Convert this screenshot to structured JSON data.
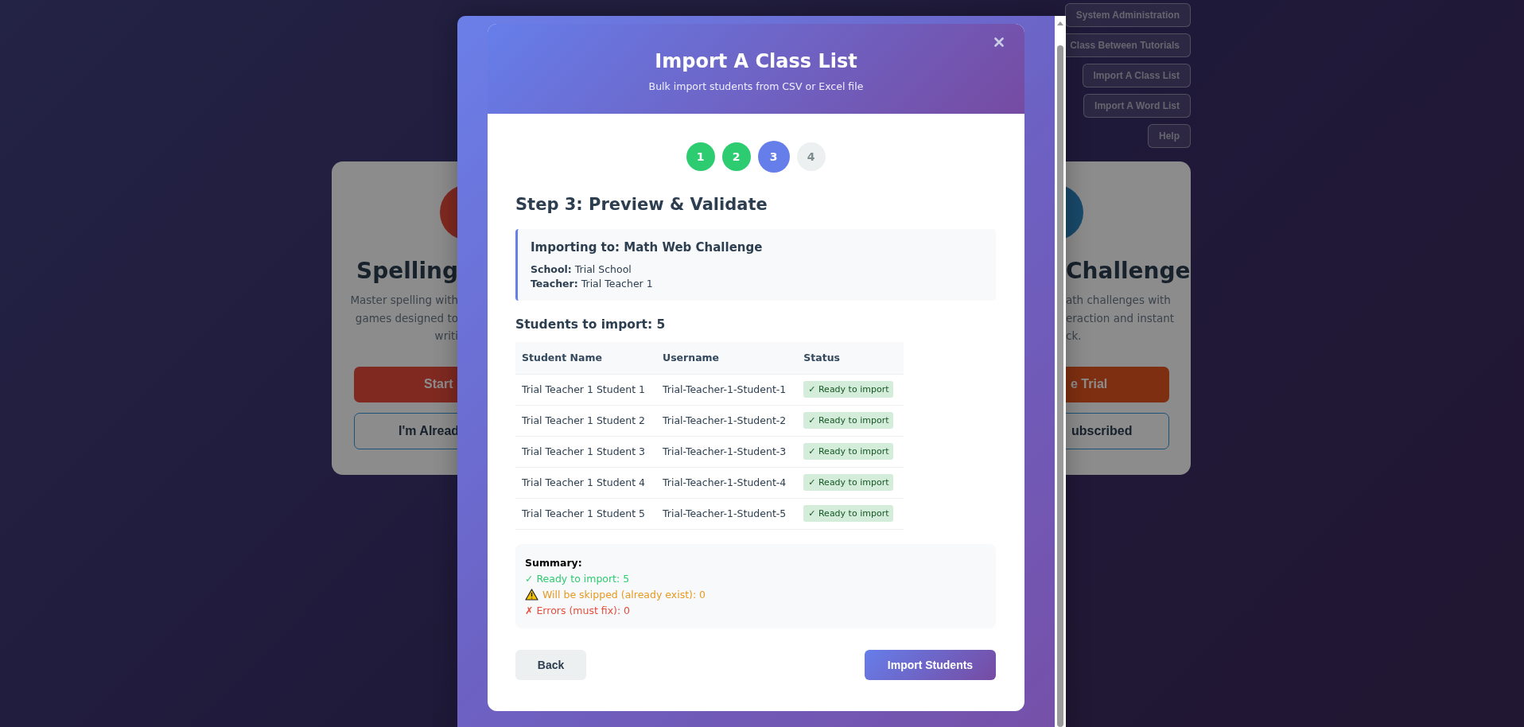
{
  "nav_buttons": [
    "System Administration",
    "Class Between Tutorials",
    "Import A Class List",
    "Import A Word List",
    "Help"
  ],
  "cards": [
    {
      "kind": "cut_right",
      "title": "Spelling",
      "description": [
        "Master spelling with",
        "games designed to",
        "writi"
      ],
      "primary_button": "Start",
      "secondary_button": "I'm Alread"
    },
    {
      "kind": "cut_left",
      "title": "Challenge",
      "description": [
        "ath challenges with",
        "eraction and instant",
        "ck."
      ],
      "primary_button": "e Trial",
      "secondary_button": "ubscribed"
    }
  ],
  "dialog": {
    "title": "Import A Class List",
    "subtitle": "Bulk import students from CSV or Excel file",
    "steps": [
      {
        "label": "1",
        "done": true,
        "selected": false
      },
      {
        "label": "2",
        "done": true,
        "selected": false
      },
      {
        "label": "3",
        "done": false,
        "selected": true
      },
      {
        "label": "4",
        "done": false,
        "selected": false
      }
    ],
    "heading": "Step 3: Preview & Validate",
    "target": {
      "title": "Importing to: Math Web Challenge",
      "lines": [
        "**School:** Trial School",
        "**Teacher:** Trial Teacher 1"
      ]
    },
    "students_heading": "Students to import: 5",
    "table": {
      "columns": [
        "Student Name",
        "Username",
        "Status"
      ],
      "rows": [
        {
          "name": "Trial Teacher 1 Student 1",
          "username": "Trial-Teacher-1-Student-1",
          "status": "✓ Ready to import"
        },
        {
          "name": "Trial Teacher 1 Student 2",
          "username": "Trial-Teacher-1-Student-2",
          "status": "✓ Ready to import"
        },
        {
          "name": "Trial Teacher 1 Student 3",
          "username": "Trial-Teacher-1-Student-3",
          "status": "✓ Ready to import"
        },
        {
          "name": "Trial Teacher 1 Student 4",
          "username": "Trial-Teacher-1-Student-4",
          "status": "✓ Ready to import"
        },
        {
          "name": "Trial Teacher 1 Student 5",
          "username": "Trial-Teacher-1-Student-5",
          "status": "✓ Ready to import"
        }
      ]
    },
    "summary": {
      "title": "Summary:",
      "lines": [
        {
          "kind": "ok",
          "text": "✓ Ready to import: 5"
        },
        {
          "kind": "warning",
          "text": "Will be skipped (already exist): 0"
        },
        {
          "kind": "error",
          "text": "✗ Errors (must fix): 0"
        }
      ]
    },
    "back_button": "Back",
    "submit_button": "Import Students"
  }
}
